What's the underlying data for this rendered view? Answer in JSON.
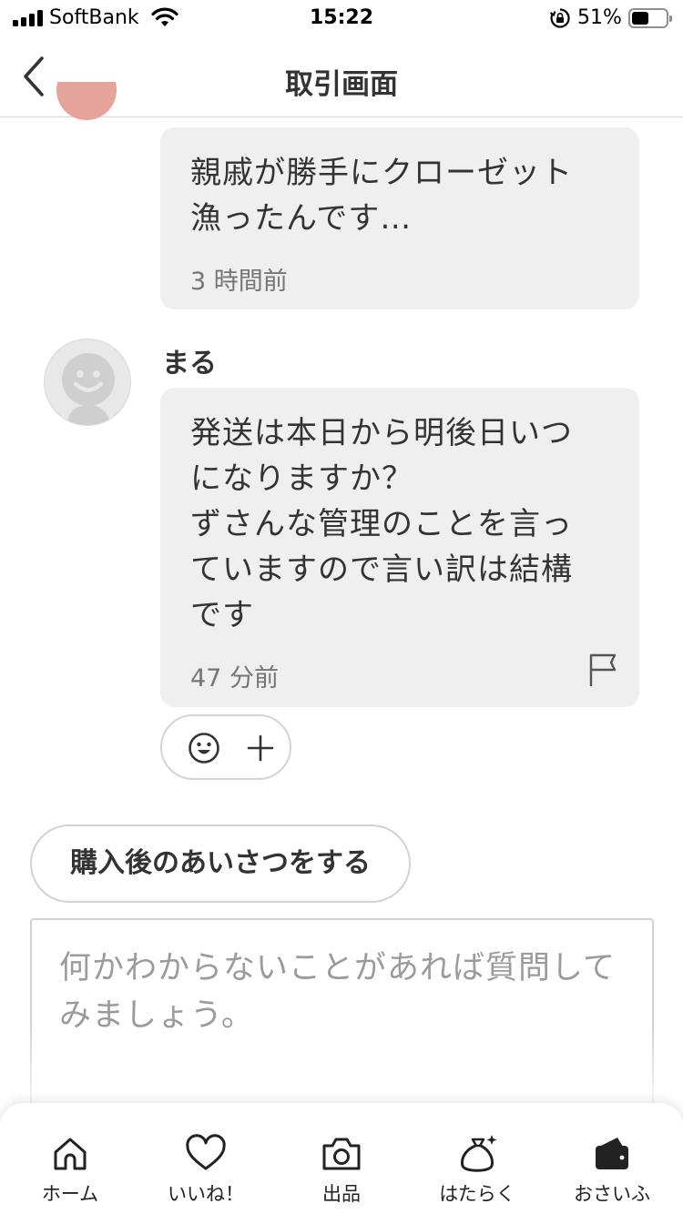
{
  "status_bar": {
    "carrier": "SoftBank",
    "time": "15:22",
    "battery_percent": "51%",
    "battery_level": 0.51,
    "icons": [
      "signal-icon",
      "wifi-icon",
      "rotation-lock-icon",
      "battery-icon"
    ]
  },
  "nav": {
    "title": "取引画面",
    "back_icon": "chevron-left-icon"
  },
  "messages": [
    {
      "text": "親戚が勝手にクローゼット\n漁ったんです…",
      "time": "3 時間前"
    },
    {
      "sender": "まる",
      "text": "発送は本日から明後日いつ\nになりますか？\nずさんな管理のことを言っ\nていますので言い訳は結構\nです",
      "time": "47 分前",
      "flag_icon": "flag-icon"
    }
  ],
  "reaction": {
    "emoji_icon": "smiley-icon",
    "add_icon": "plus-icon"
  },
  "greeting_button": "購入後のあいさつをする",
  "input": {
    "placeholder": "何かわからないことがあれば質問してみましょう。"
  },
  "tabs": [
    {
      "label": "ホーム",
      "icon": "home-icon"
    },
    {
      "label": "いいね！",
      "icon": "heart-icon"
    },
    {
      "label": "出品",
      "icon": "camera-icon"
    },
    {
      "label": "はたらく",
      "icon": "money-bag-icon"
    },
    {
      "label": "おさいふ",
      "icon": "wallet-icon"
    }
  ],
  "colors": {
    "bubble": "#efefef",
    "text": "#333333",
    "muted": "#757575",
    "border": "#d2d2d2"
  }
}
